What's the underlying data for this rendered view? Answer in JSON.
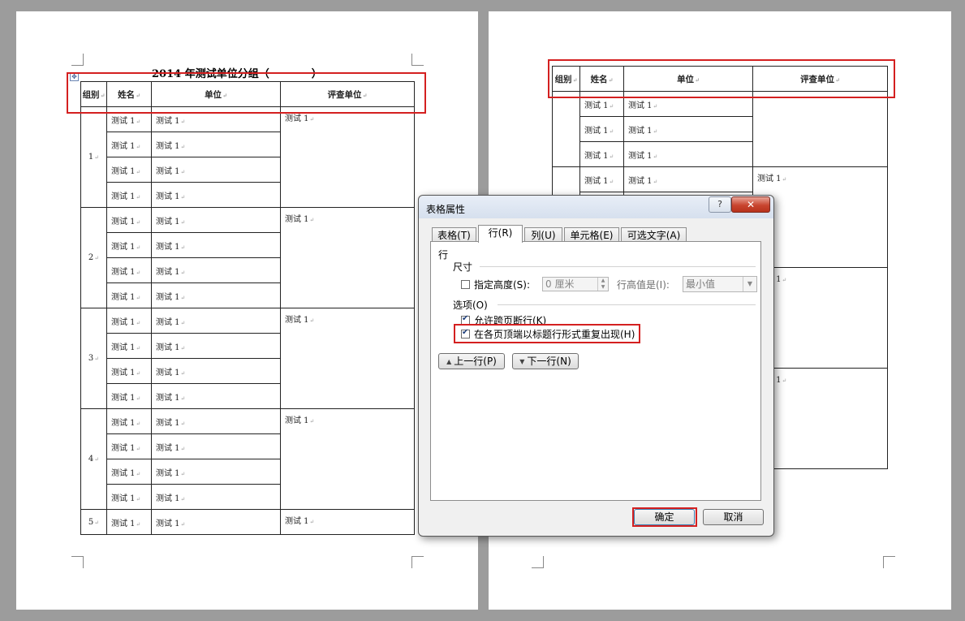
{
  "document": {
    "title_left": "2014 年测试单位分组（",
    "title_right": "）",
    "headers": [
      "组别",
      "姓名",
      "单位",
      "评查单位"
    ],
    "cell_name": "测试 1",
    "cell_unit": "测试 1",
    "cell_review": "测试 1",
    "groups": [
      "1",
      "2",
      "3",
      "4",
      "5"
    ]
  },
  "dialog": {
    "title": "表格属性",
    "help": "?",
    "close": "✕",
    "tabs": [
      "表格(T)",
      "行(R)",
      "列(U)",
      "单元格(E)",
      "可选文字(A)"
    ],
    "active_tab": "行(R)",
    "section_row": "行",
    "section_size": "尺寸",
    "specify_height_label": "指定高度(S):",
    "specify_height_checked": false,
    "height_value": "0 厘米",
    "row_height_is_label": "行高值是(I):",
    "row_height_is_value": "最小值",
    "options_label": "选项(O)",
    "allow_break_label": "允许跨页断行(K)",
    "allow_break_checked": true,
    "repeat_header_label": "在各页顶端以标题行形式重复出现(H)",
    "repeat_header_checked": true,
    "prev_row_label": "上一行(P)",
    "next_row_label": "下一行(N)",
    "ok_label": "确定",
    "cancel_label": "取消"
  },
  "colors": {
    "highlight": "#d42020",
    "check": "#1d3e7a"
  },
  "icons": [
    "move-table-icon",
    "help-icon",
    "close-icon",
    "triangle-up-icon",
    "triangle-down-icon",
    "spinner-icon",
    "dropdown-arrow-icon"
  ]
}
